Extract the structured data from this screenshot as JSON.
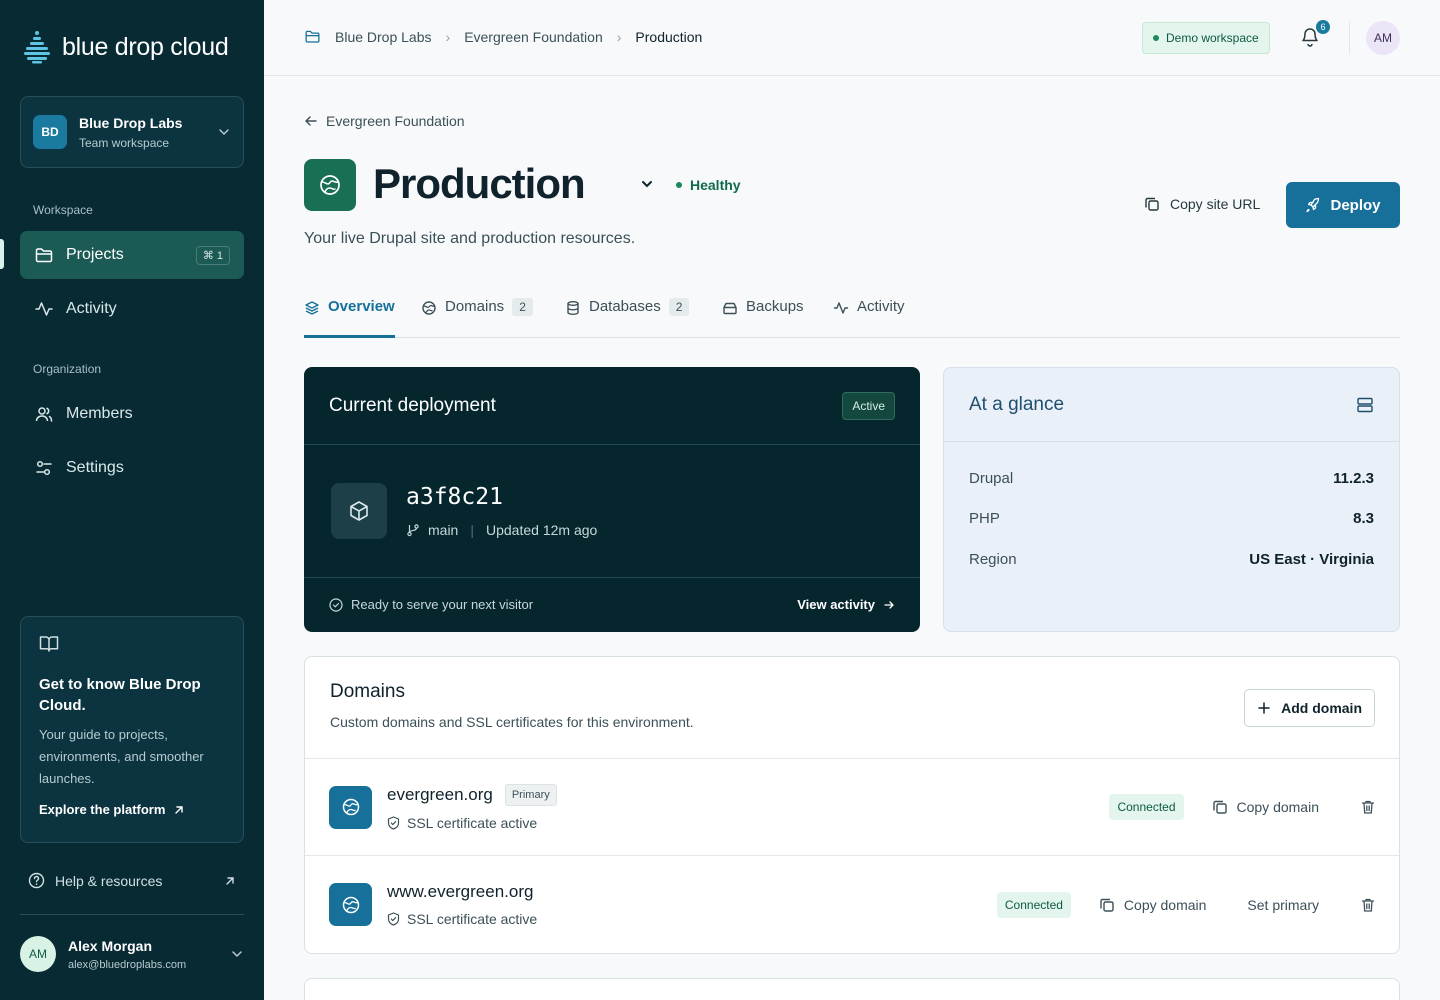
{
  "brand": {
    "name": "blue drop cloud"
  },
  "workspace": {
    "initials": "BD",
    "name": "Blue Drop Labs",
    "type": "Team workspace"
  },
  "sidebar": {
    "workspace_label": "Workspace",
    "items": [
      {
        "label": "Projects",
        "shortcut": "⌘ 1",
        "active": true,
        "icon": "folder-icon"
      },
      {
        "label": "Activity",
        "icon": "activity-icon"
      }
    ],
    "org_label": "Organization",
    "org_items": [
      {
        "label": "Members",
        "icon": "users-icon"
      },
      {
        "label": "Settings",
        "icon": "sliders-icon"
      }
    ],
    "guide": {
      "title": "Get to know Blue Drop Cloud.",
      "text": "Your guide to projects, environments, and smoother launches.",
      "link": "Explore the platform"
    },
    "help": "Help & resources",
    "user": {
      "initials": "AM",
      "name": "Alex Morgan",
      "email": "alex@bluedroplabs.com"
    }
  },
  "topbar": {
    "breadcrumbs": [
      "Blue Drop Labs",
      "Evergreen Foundation",
      "Production"
    ],
    "demo_badge": "Demo workspace",
    "notifications": "6",
    "avatar": "AM"
  },
  "page": {
    "back_label": "Evergreen Foundation",
    "title": "Production",
    "status": "Healthy",
    "subtitle": "Your live Drupal site and production resources.",
    "copy_url": "Copy site URL",
    "deploy": "Deploy"
  },
  "tabs": [
    {
      "label": "Overview",
      "active": true,
      "icon": "layers-icon"
    },
    {
      "label": "Domains",
      "count": "2",
      "icon": "globe-icon"
    },
    {
      "label": "Databases",
      "count": "2",
      "icon": "database-icon"
    },
    {
      "label": "Backups",
      "icon": "archive-icon"
    },
    {
      "label": "Activity",
      "icon": "activity-icon"
    }
  ],
  "deployment": {
    "title": "Current deployment",
    "badge": "Active",
    "commit": "a3f8c21",
    "branch": "main",
    "updated": "Updated 12m ago",
    "footer": "Ready to serve your next visitor",
    "view": "View activity"
  },
  "glance": {
    "title": "At a glance",
    "rows": [
      {
        "k": "Drupal",
        "v": "11.2.3"
      },
      {
        "k": "PHP",
        "v": "8.3"
      },
      {
        "k": "Region",
        "v": "US East · Virginia"
      }
    ]
  },
  "domains": {
    "title": "Domains",
    "subtitle": "Custom domains and SSL certificates for this environment.",
    "add": "Add domain",
    "items": [
      {
        "name": "evergreen.org",
        "primary": "Primary",
        "ssl": "SSL certificate active",
        "status": "Connected",
        "copy": "Copy domain"
      },
      {
        "name": "www.evergreen.org",
        "ssl": "SSL certificate active",
        "status": "Connected",
        "copy": "Copy domain",
        "set_primary": "Set primary"
      }
    ]
  },
  "colors": {
    "sidebar": "#072a33",
    "accent": "#17709a",
    "success": "#126a4c"
  }
}
